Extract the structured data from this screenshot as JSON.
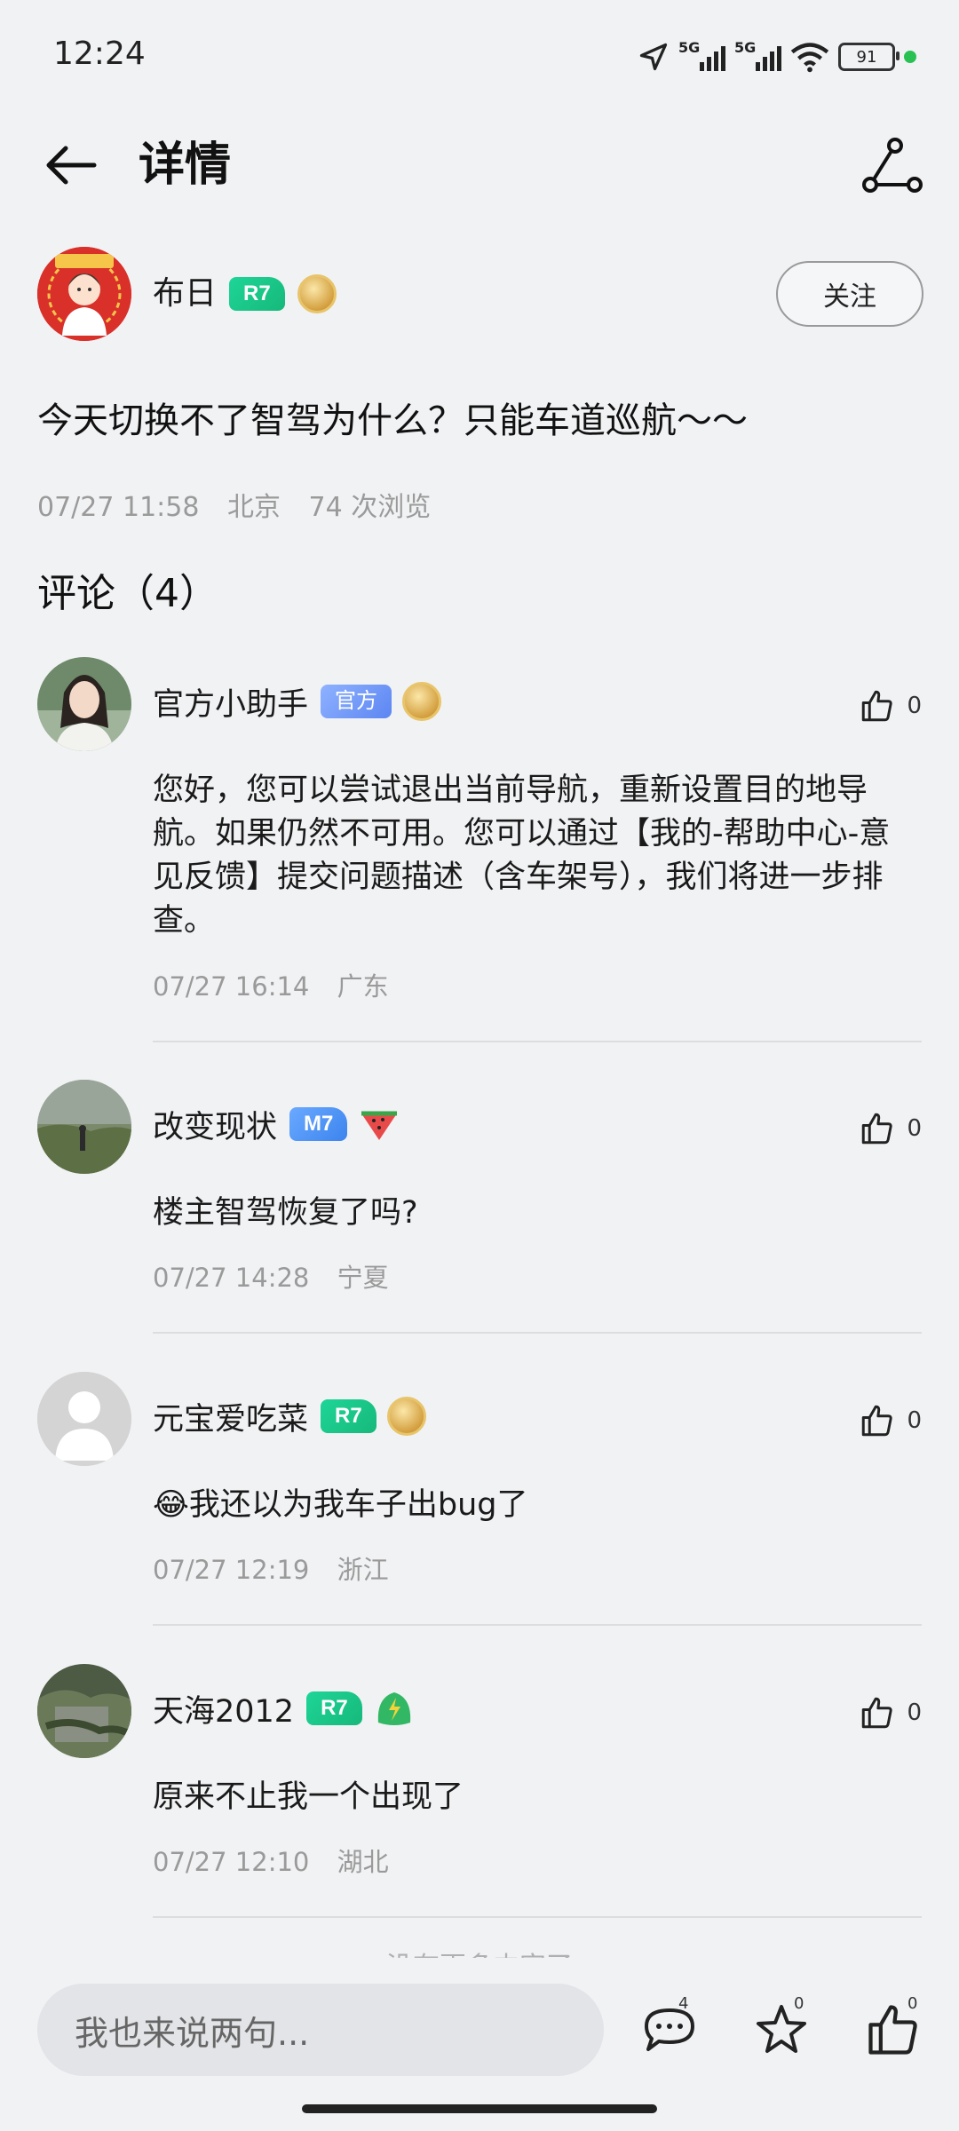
{
  "status_bar": {
    "time": "12:24",
    "network_1": "5G",
    "network_2": "5G",
    "battery": "91"
  },
  "header": {
    "title": "详情"
  },
  "author": {
    "name": "布日",
    "level_badge": "R7",
    "follow_label": "关注"
  },
  "post": {
    "text": "今天切换不了智驾为什么？只能车道巡航～～",
    "date": "07/27 11:58",
    "location": "北京",
    "views": "74 次浏览"
  },
  "comments_title": "评论（4）",
  "comments": [
    {
      "name": "官方小助手",
      "badge": "官方",
      "badge_type": "official",
      "likes": "0",
      "text": "您好，您可以尝试退出当前导航，重新设置目的地导航。如果仍然不可用。您可以通过【我的-帮助中心-意见反馈】提交问题描述（含车架号），我们将进一步排查。",
      "date": "07/27 16:14",
      "location": "广东",
      "secondary_icon": "medal-icon"
    },
    {
      "name": "改变现状",
      "badge": "M7",
      "badge_type": "blue",
      "likes": "0",
      "text": "楼主智驾恢复了吗?",
      "date": "07/27 14:28",
      "location": "宁夏",
      "secondary_icon": "watermelon-icon"
    },
    {
      "name": "元宝爱吃菜",
      "badge": "R7",
      "badge_type": "green",
      "likes": "0",
      "text": "😂我还以为我车子出bug了",
      "date": "07/27 12:19",
      "location": "浙江",
      "secondary_icon": "medal-icon"
    },
    {
      "name": "天海2012",
      "badge": "R7",
      "badge_type": "green",
      "likes": "0",
      "text": "原来不止我一个出现了",
      "date": "07/27 12:10",
      "location": "湖北",
      "secondary_icon": "leaf-bolt-icon"
    }
  ],
  "no_more": "没有更多内容了",
  "bottom_bar": {
    "input_placeholder": "我也来说两句...",
    "comment_count": "4",
    "favorite_count": "0",
    "like_count": "0"
  },
  "colors": {
    "background": "#f1f2f4",
    "badge_green": "#16b97a",
    "badge_blue": "#3c84ee",
    "official": "#5c86f2"
  }
}
